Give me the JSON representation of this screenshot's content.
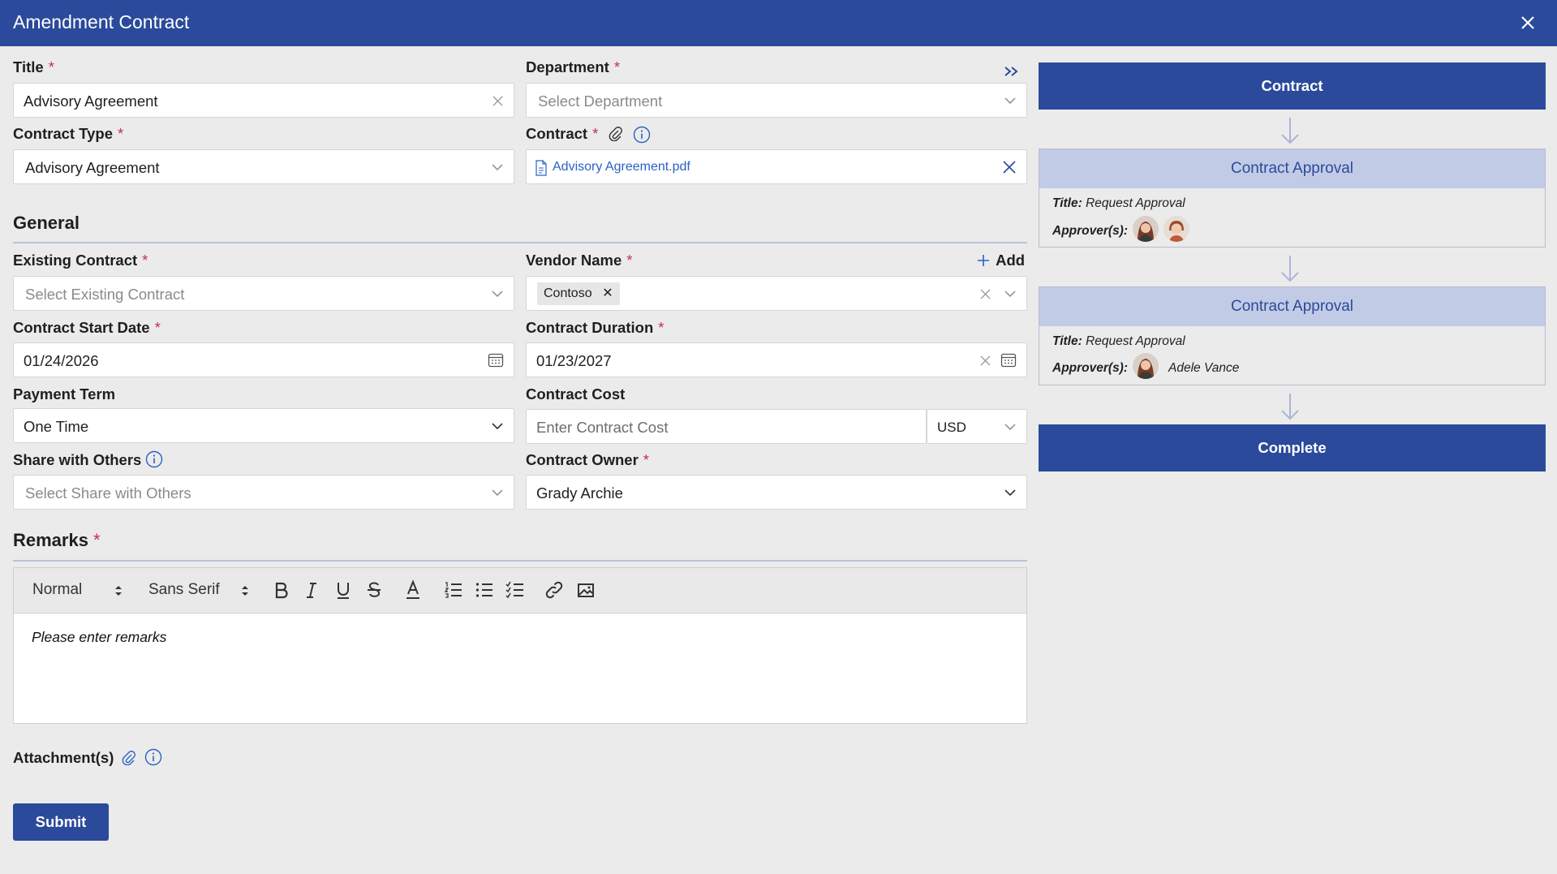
{
  "window": {
    "title": "Amendment Contract"
  },
  "required_marker": "*",
  "form": {
    "title": {
      "label": "Title",
      "value": "Advisory Agreement"
    },
    "department": {
      "label": "Department",
      "placeholder": "Select Department"
    },
    "contract_type": {
      "label": "Contract Type",
      "value": "Advisory Agreement"
    },
    "contract": {
      "label": "Contract",
      "file_name": "Advisory Agreement.pdf"
    },
    "general": {
      "heading": "General",
      "existing_contract": {
        "label": "Existing Contract",
        "placeholder": "Select Existing Contract"
      },
      "vendor_name": {
        "label": "Vendor Name",
        "add_label": "Add",
        "chips": [
          "Contoso"
        ]
      },
      "contract_start_date": {
        "label": "Contract Start Date",
        "value": "01/24/2026"
      },
      "contract_duration": {
        "label": "Contract Duration",
        "value": "01/23/2027"
      },
      "payment_term": {
        "label": "Payment Term",
        "value": "One Time"
      },
      "contract_cost": {
        "label": "Contract Cost",
        "placeholder": "Enter Contract Cost",
        "currency": "USD"
      },
      "share_with_others": {
        "label": "Share with Others",
        "placeholder": "Select Share with Others"
      },
      "contract_owner": {
        "label": "Contract Owner",
        "value": "Grady Archie"
      }
    },
    "remarks": {
      "heading": "Remarks",
      "toolbar": {
        "format": "Normal",
        "font": "Sans Serif"
      },
      "placeholder": "Please enter remarks"
    },
    "attachments": {
      "label": "Attachment(s)"
    },
    "submit_label": "Submit"
  },
  "workflow": {
    "start": "Contract",
    "steps": [
      {
        "heading": "Contract Approval",
        "title_label": "Title:",
        "title_value": "Request Approval",
        "approvers_label": "Approver(s):",
        "approver_names": ""
      },
      {
        "heading": "Contract Approval",
        "title_label": "Title:",
        "title_value": "Request Approval",
        "approvers_label": "Approver(s):",
        "approver_names": "Adele Vance"
      }
    ],
    "end": "Complete"
  },
  "colors": {
    "brand": "#2b4a9b",
    "card_header": "#c2cbe6",
    "required": "#c4314b",
    "link": "#2b62c4"
  }
}
